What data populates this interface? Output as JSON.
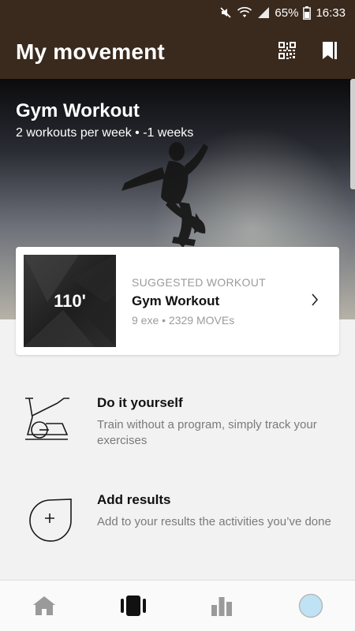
{
  "status_bar": {
    "battery": "65%",
    "time": "16:33",
    "icons": [
      "mute-icon",
      "wifi-icon",
      "signal-icon",
      "battery-icon"
    ]
  },
  "app_bar": {
    "title": "My movement",
    "actions": [
      "qr-code-icon",
      "bookmark-icon"
    ]
  },
  "hero": {
    "title": "Gym Workout",
    "subtitle": "2 workouts per week • -1 weeks"
  },
  "suggested": {
    "duration": "110'",
    "kicker": "SUGGESTED WORKOUT",
    "title": "Gym Workout",
    "meta": "9 exe • 2329 MOVEs"
  },
  "options": [
    {
      "icon": "exercise-bike-icon",
      "title": "Do it yourself",
      "description": "Train without a program, simply track your exercises"
    },
    {
      "icon": "add-circle-icon",
      "title": "Add results",
      "description": "Add to your results the activities you’ve done"
    }
  ],
  "bottom_nav": {
    "items": [
      "home-icon",
      "workout-icon",
      "stats-icon",
      "profile-icon"
    ],
    "active": "workout-icon"
  },
  "colors": {
    "app_bar": "#3a2a1d",
    "muted_text": "#9b9b9b",
    "profile_accent": "#bfe3f5"
  }
}
